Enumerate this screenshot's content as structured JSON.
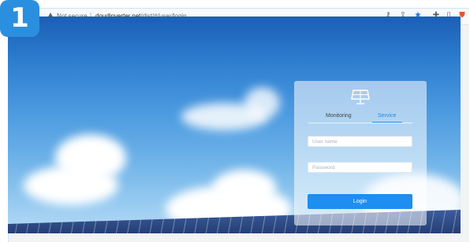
{
  "step_badge": "1",
  "browser": {
    "security_label": "Not secure",
    "separator": "|",
    "url_host": "doudinverter.net",
    "url_path": "/dist/#/user/login"
  },
  "icons": {
    "warning": "warning-triangle-icon",
    "key": "key-icon",
    "share": "share-icon",
    "bookmark": "star-icon",
    "extensions": "puzzle-icon",
    "side_panel": "panel-icon",
    "brave": "shield-icon"
  },
  "login": {
    "tabs": [
      {
        "label": "Monitoring",
        "active": false
      },
      {
        "label": "Service",
        "active": true
      }
    ],
    "username_placeholder": "User name",
    "password_placeholder": "Password",
    "login_label": "Login"
  },
  "colors": {
    "accent": "#1e8ef0",
    "badge": "#2b8fe0"
  }
}
